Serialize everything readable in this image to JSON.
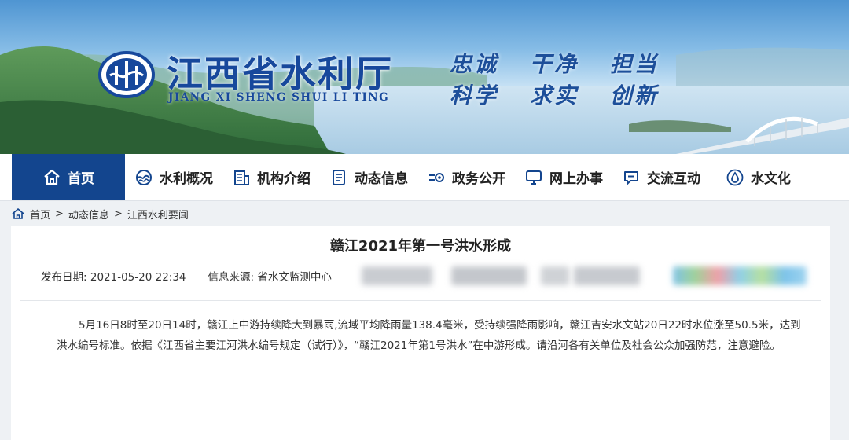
{
  "header": {
    "site_name_cn": "江西省水利厅",
    "site_name_en": "JIANG XI SHENG SHUI LI TING",
    "slogan_line1": [
      "忠诚",
      "干净",
      "担当"
    ],
    "slogan_line2": [
      "科学",
      "求实",
      "创新"
    ],
    "brand_color": "#13458e"
  },
  "nav": {
    "items": [
      {
        "label": "首页",
        "icon": "home-icon",
        "active": true
      },
      {
        "label": "水利概况",
        "icon": "water-overview-icon"
      },
      {
        "label": "机构介绍",
        "icon": "building-icon"
      },
      {
        "label": "动态信息",
        "icon": "document-icon"
      },
      {
        "label": "政务公开",
        "icon": "gov-open-icon"
      },
      {
        "label": "网上办事",
        "icon": "monitor-icon"
      },
      {
        "label": "交流互动",
        "icon": "chat-icon"
      },
      {
        "label": "水文化",
        "icon": "water-drop-icon"
      }
    ]
  },
  "breadcrumb": {
    "items": [
      "首页",
      "动态信息",
      "江西水利要闻"
    ],
    "separator": ">"
  },
  "article": {
    "title": "赣江2021年第一号洪水形成",
    "publish_label": "发布日期:",
    "publish_date": "2021-05-20 22:34",
    "source_label": "信息来源:",
    "source": "省水文监测中心",
    "body": "5月16日8时至20日14时，赣江上中游持续降大到暴雨,流域平均降雨量138.4毫米，受持续强降雨影响，赣江吉安水文站20日22时水位涨至50.5米，达到洪水编号标准。依据《江西省主要江河洪水编号规定（试行）》，“赣江2021年第1号洪水”在中游形成。请沿河各有关单位及社会公众加强防范，注意避险。"
  }
}
